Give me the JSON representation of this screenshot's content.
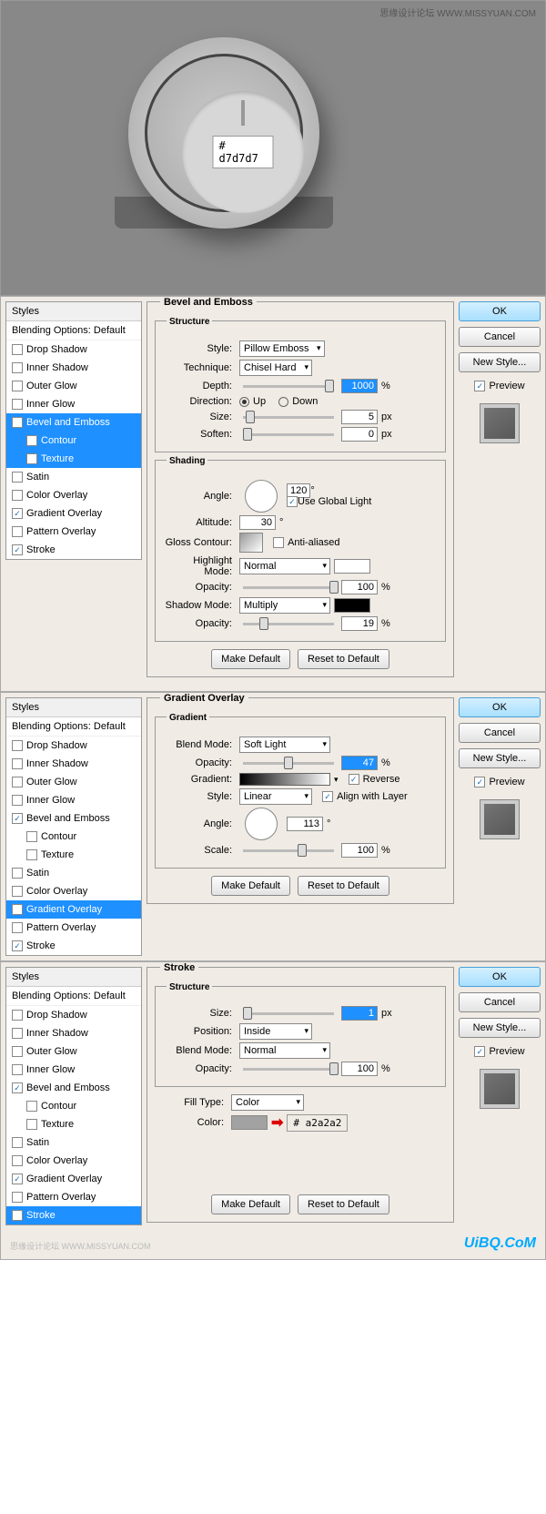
{
  "topImage": {
    "watermark": "思缘设计论坛 WWW.MISSYUAN.COM",
    "hexValue": "# d7d7d7"
  },
  "stylesPanel": {
    "header": "Styles",
    "blendingOptions": "Blending Options: Default",
    "items": [
      {
        "label": "Drop Shadow",
        "checked": false,
        "indent": false
      },
      {
        "label": "Inner Shadow",
        "checked": false,
        "indent": false
      },
      {
        "label": "Outer Glow",
        "checked": false,
        "indent": false
      },
      {
        "label": "Inner Glow",
        "checked": false,
        "indent": false
      },
      {
        "label": "Bevel and Emboss",
        "checked": true,
        "indent": false
      },
      {
        "label": "Contour",
        "checked": false,
        "indent": true
      },
      {
        "label": "Texture",
        "checked": false,
        "indent": true
      },
      {
        "label": "Satin",
        "checked": false,
        "indent": false
      },
      {
        "label": "Color Overlay",
        "checked": false,
        "indent": false
      },
      {
        "label": "Gradient Overlay",
        "checked": true,
        "indent": false
      },
      {
        "label": "Pattern Overlay",
        "checked": false,
        "indent": false
      },
      {
        "label": "Stroke",
        "checked": true,
        "indent": false
      }
    ]
  },
  "rightButtons": {
    "ok": "OK",
    "cancel": "Cancel",
    "newStyle": "New Style...",
    "preview": "Preview"
  },
  "bevel": {
    "title": "Bevel and Emboss",
    "structure": "Structure",
    "styleLabel": "Style:",
    "styleValue": "Pillow Emboss",
    "techniqueLabel": "Technique:",
    "techniqueValue": "Chisel Hard",
    "depthLabel": "Depth:",
    "depthValue": "1000",
    "depthUnit": "%",
    "directionLabel": "Direction:",
    "up": "Up",
    "down": "Down",
    "sizeLabel": "Size:",
    "sizeValue": "5",
    "sizeUnit": "px",
    "softenLabel": "Soften:",
    "softenValue": "0",
    "softenUnit": "px",
    "shading": "Shading",
    "angleLabel": "Angle:",
    "angleValue": "120",
    "deg": "°",
    "useGlobal": "Use Global Light",
    "altLabel": "Altitude:",
    "altValue": "30",
    "glossLabel": "Gloss Contour:",
    "antiAliased": "Anti-aliased",
    "hlModeLabel": "Highlight Mode:",
    "hlModeValue": "Normal",
    "opacityLabel": "Opacity:",
    "hlOpacity": "100",
    "shModeLabel": "Shadow Mode:",
    "shModeValue": "Multiply",
    "shOpacity": "19",
    "makeDefault": "Make Default",
    "resetDefault": "Reset to Default"
  },
  "gradient": {
    "title": "Gradient Overlay",
    "sub": "Gradient",
    "blendModeLabel": "Blend Mode:",
    "blendModeValue": "Soft Light",
    "opacityLabel": "Opacity:",
    "opacityValue": "47",
    "pct": "%",
    "gradientLabel": "Gradient:",
    "reverse": "Reverse",
    "styleLabel": "Style:",
    "styleValue": "Linear",
    "align": "Align with Layer",
    "angleLabel": "Angle:",
    "angleValue": "113",
    "deg": "°",
    "scaleLabel": "Scale:",
    "scaleValue": "100",
    "makeDefault": "Make Default",
    "resetDefault": "Reset to Default"
  },
  "stroke": {
    "title": "Stroke",
    "structure": "Structure",
    "sizeLabel": "Size:",
    "sizeValue": "1",
    "sizeUnit": "px",
    "positionLabel": "Position:",
    "positionValue": "Inside",
    "blendModeLabel": "Blend Mode:",
    "blendModeValue": "Normal",
    "opacityLabel": "Opacity:",
    "opacityValue": "100",
    "pct": "%",
    "fillTypeLabel": "Fill Type:",
    "fillTypeValue": "Color",
    "colorLabel": "Color:",
    "hexValue": "# a2a2a2",
    "makeDefault": "Make Default",
    "resetDefault": "Reset to Default"
  },
  "footer": {
    "watermark": "思缘设计论坛 WWW.MISSYUAN.COM",
    "logo": "UiBQ.CoM"
  }
}
